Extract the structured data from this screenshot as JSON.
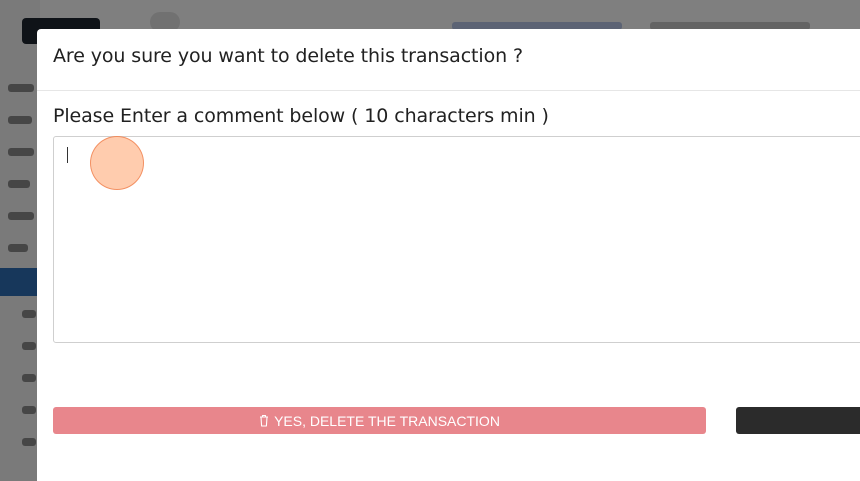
{
  "modal": {
    "title": "Are you sure you want to delete this transaction ?",
    "comment_label": "Please Enter a comment below ( 10 characters min )",
    "comment_value": "",
    "delete_button_label": "YES, DELETE THE TRANSACTION",
    "delete_icon": "trash-icon",
    "cancel_button_label": ""
  },
  "colors": {
    "delete_button": "#e8868c",
    "cancel_button": "#2b2b2b",
    "overlay": "rgba(0,0,0,0.5)",
    "sidebar_active": "#2f6fb7"
  }
}
